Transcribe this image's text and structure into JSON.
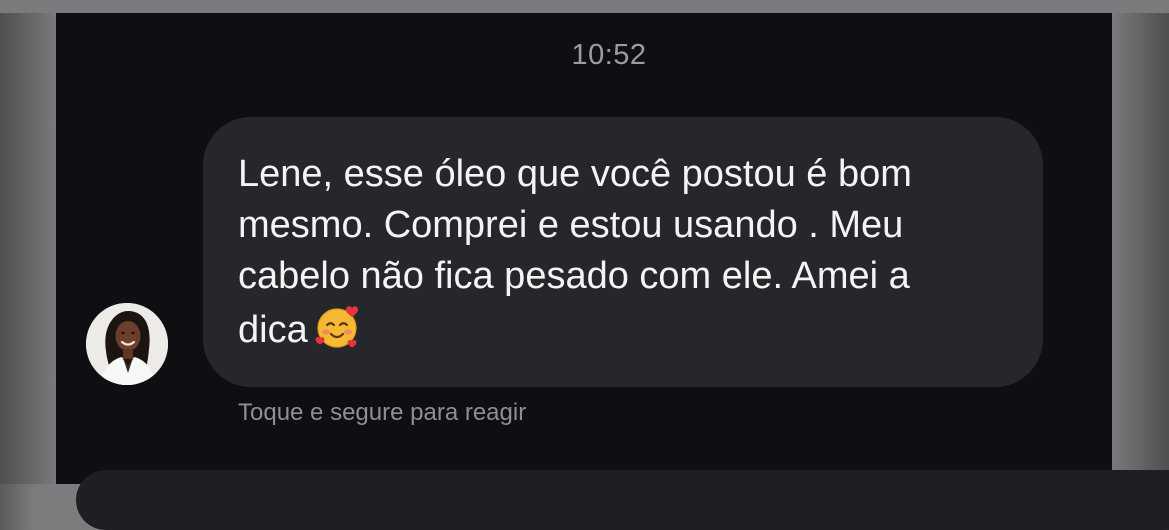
{
  "chat": {
    "timestamp": "10:52",
    "message": {
      "text": "Lene, esse óleo que você postou é bom\nmesmo. Comprei e estou usando . Meu\ncabelo não fica pesado com ele. Amei a\ndica",
      "emoji": "smiling-face-with-hearts-icon"
    },
    "react_hint": "Toque e segure para reagir"
  },
  "colors": {
    "screen_background": "#0e0f12",
    "bubble_background": "#25272b",
    "message_text": "#f4f4f5",
    "timestamp_text": "#9a9ca3",
    "hint_text": "#8d8f95",
    "frame_gray": "#7c7c7e"
  }
}
